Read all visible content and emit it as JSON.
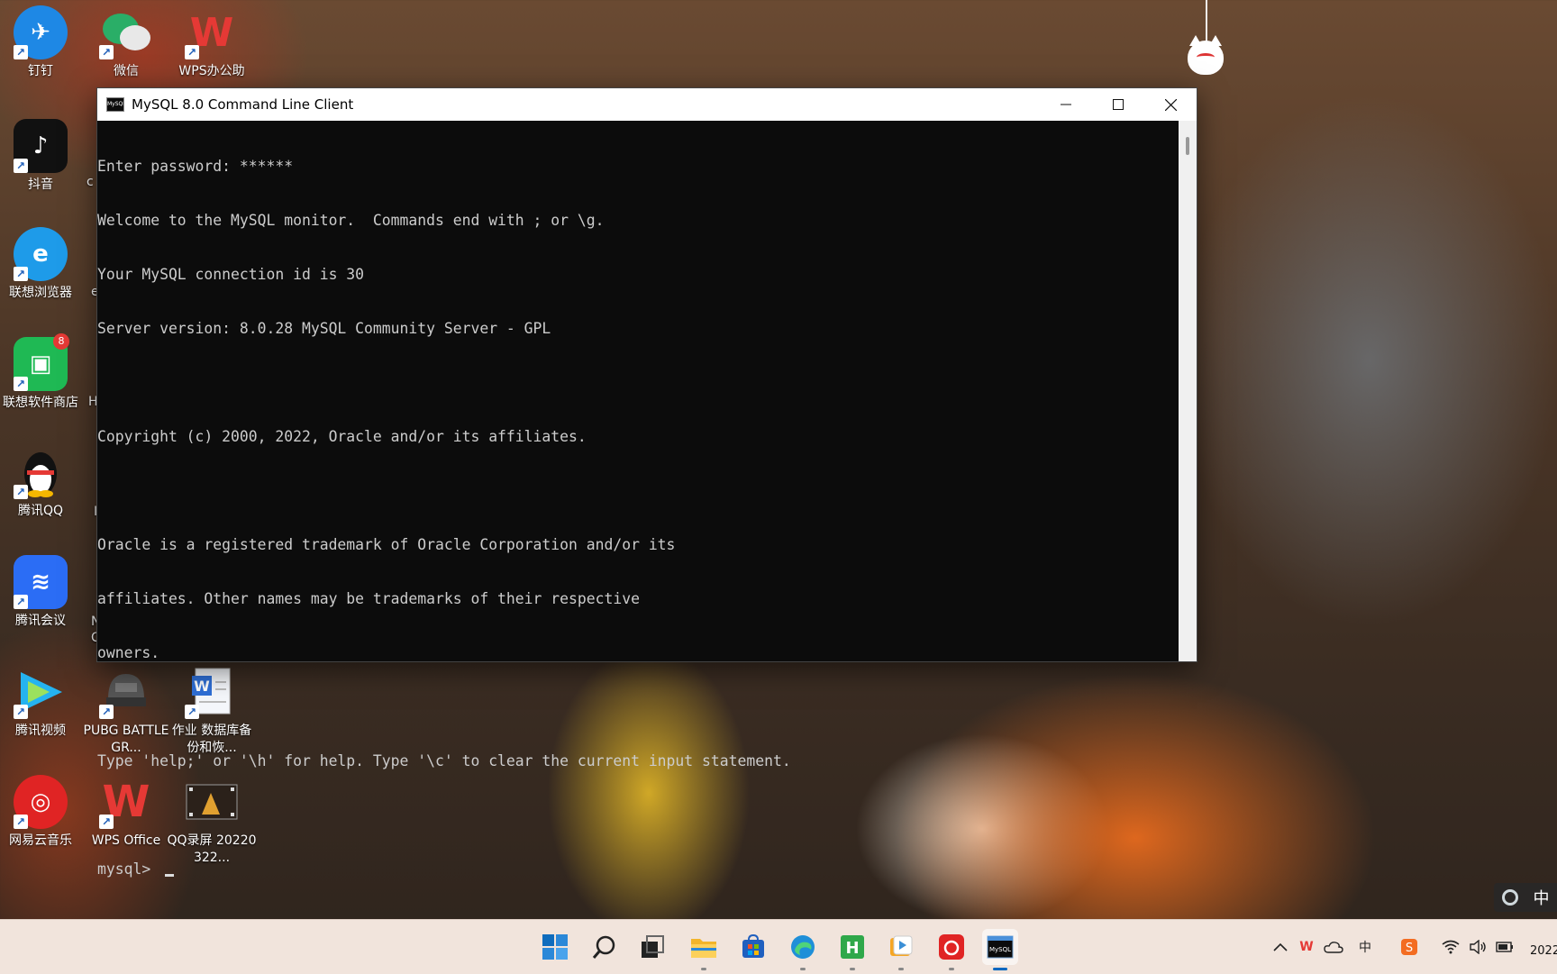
{
  "desktop": {
    "icons": [
      {
        "label": "钉钉",
        "color": "#1e88e5",
        "glyph": "✈"
      },
      {
        "label": "微信",
        "color": "#2aae67",
        "glyph": "💬"
      },
      {
        "label": "WPS办公助",
        "color": "#e53935",
        "glyph": "W"
      },
      {
        "label": "抖音",
        "color": "#111111",
        "glyph": "♪"
      },
      {
        "label": "联想浏览器",
        "color": "#1e9be9",
        "glyph": "e"
      },
      {
        "label": "联想软件商店",
        "color": "#1fb954",
        "glyph": "🛍",
        "badge": "8"
      },
      {
        "label": "腾讯QQ",
        "color": "#1a1a1a",
        "glyph": "🐧"
      },
      {
        "label": "腾讯会议",
        "color": "#2b6df5",
        "glyph": "M"
      },
      {
        "label": "腾讯视频",
        "color": "#25b3f0",
        "glyph": "▶"
      },
      {
        "label": "PUBG BATTLEGR...",
        "color": "#5b5b5b",
        "glyph": "⛑"
      },
      {
        "label": "作业 数据库备份和恢...",
        "color": "#2f6fd6",
        "glyph": "W"
      },
      {
        "label": "网易云音乐",
        "color": "#e02424",
        "glyph": "◎"
      },
      {
        "label": "WPS Office",
        "color": "#e53935",
        "glyph": "W"
      },
      {
        "label": "QQ录屏 20220322...",
        "color": "#3a2b20",
        "glyph": "🎞"
      }
    ],
    "partial_labels": [
      "c",
      "e",
      "H",
      "I",
      "N",
      "C"
    ]
  },
  "window": {
    "title": "MySQL 8.0 Command Line Client",
    "app_icon_text": "MySQL",
    "minimize_label": "minimize",
    "maximize_label": "maximize",
    "close_label": "close"
  },
  "console": {
    "lines": [
      "Enter password: ******",
      "Welcome to the MySQL monitor.  Commands end with ; or \\g.",
      "Your MySQL connection id is 30",
      "Server version: 8.0.28 MySQL Community Server - GPL",
      "",
      "Copyright (c) 2000, 2022, Oracle and/or its affiliates.",
      "",
      "Oracle is a registered trademark of Oracle Corporation and/or its",
      "affiliates. Other names may be trademarks of their respective",
      "owners.",
      "",
      "Type 'help;' or '\\h' for help. Type '\\c' to clear the current input statement.",
      ""
    ],
    "prompt": "mysql> "
  },
  "ime": {
    "mode": "中"
  },
  "taskbar": {
    "apps": [
      {
        "name": "start-icon"
      },
      {
        "name": "search-icon"
      },
      {
        "name": "task-view-icon"
      },
      {
        "name": "file-explorer-icon"
      },
      {
        "name": "store-icon"
      },
      {
        "name": "edge-icon"
      },
      {
        "name": "hbuilder-icon"
      },
      {
        "name": "media-player-icon"
      },
      {
        "name": "netease-music-icon"
      },
      {
        "name": "mysql-console-icon",
        "active": true
      }
    ],
    "tray": {
      "ime_text": "中",
      "clock": "2022"
    }
  }
}
